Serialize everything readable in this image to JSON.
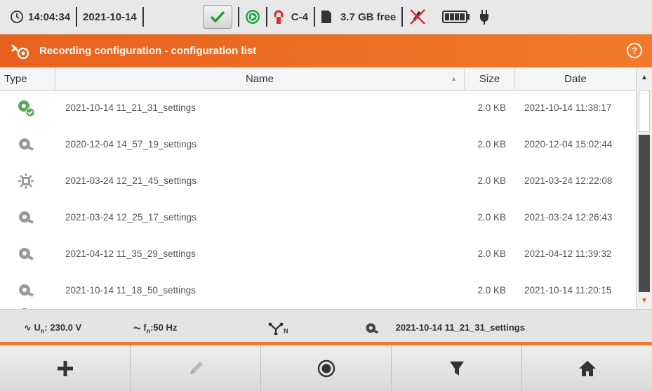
{
  "status": {
    "time": "14:04:34",
    "date": "2021-10-14",
    "clamp": "C-4",
    "storage": "3.7 GB free"
  },
  "header": {
    "title": "Recording configuration - configuration list",
    "help": "?"
  },
  "table": {
    "columns": {
      "type": "Type",
      "name": "Name",
      "size": "Size",
      "date": "Date"
    },
    "rows": [
      {
        "icon": "active-settings-icon",
        "name": "2021-10-14 11_21_31_settings",
        "size": "2.0 KB",
        "date": "2021-10-14 11:38:17"
      },
      {
        "icon": "settings-icon",
        "name": "2020-12-04 14_57_19_settings",
        "size": "2.0 KB",
        "date": "2020-12-04 15:02:44"
      },
      {
        "icon": "gear-settings-icon",
        "name": "2021-03-24 12_21_45_settings",
        "size": "2.0 KB",
        "date": "2021-03-24 12:22:08"
      },
      {
        "icon": "settings-icon",
        "name": "2021-03-24 12_25_17_settings",
        "size": "2.0 KB",
        "date": "2021-03-24 12:26:43"
      },
      {
        "icon": "settings-icon",
        "name": "2021-04-12 11_35_29_settings",
        "size": "2.0 KB",
        "date": "2021-04-12 11:39:32"
      },
      {
        "icon": "settings-icon",
        "name": "2021-10-14 11_18_50_settings",
        "size": "2.0 KB",
        "date": "2021-10-14 11:20:15"
      }
    ]
  },
  "info": {
    "voltage_label": "U",
    "voltage_sub": "n",
    "voltage_value": ": 230.0 V",
    "freq_label": "f",
    "freq_sub": "n",
    "freq_value": ":50 Hz",
    "network_sub": "N",
    "active_config": "2021-10-14 11_21_31_settings"
  },
  "toolbar": {
    "buttons": [
      "add-button",
      "edit-button",
      "record-button",
      "filter-button",
      "home-button"
    ]
  },
  "colors": {
    "accent": "#f07a2a",
    "active_icon": "#4caf50",
    "icon_grey": "#9a9a9a"
  }
}
